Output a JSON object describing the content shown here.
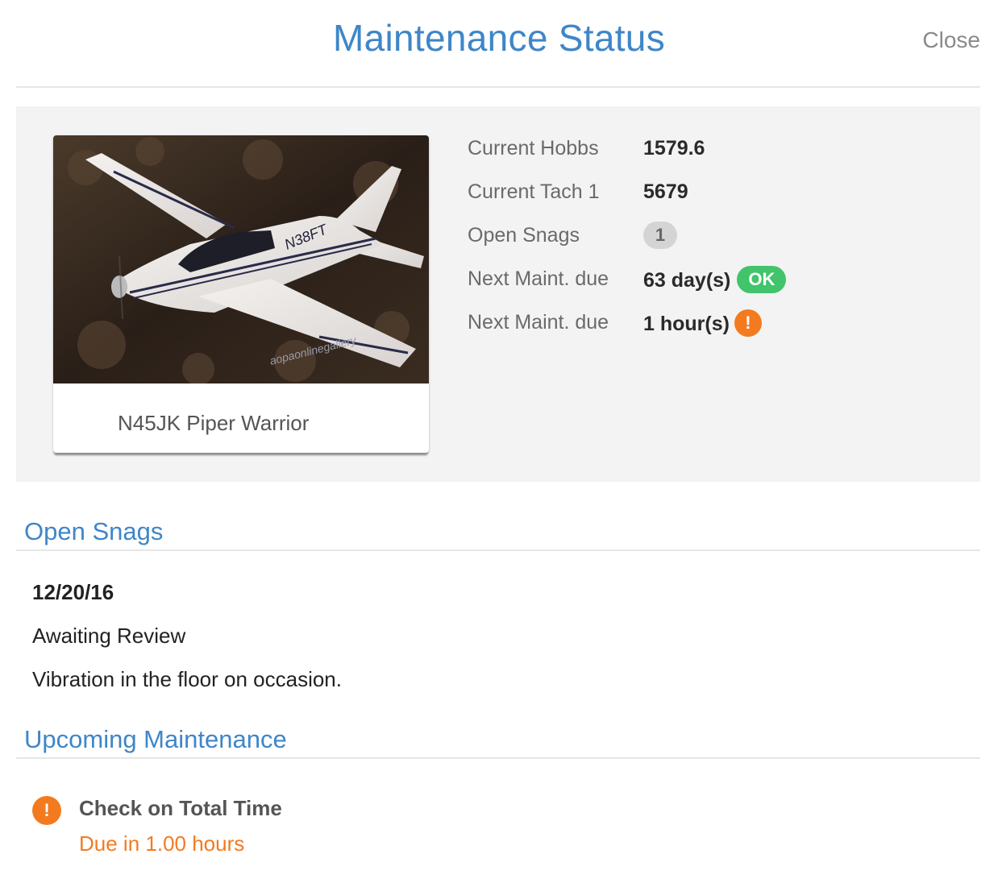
{
  "header": {
    "title": "Maintenance Status",
    "close_label": "Close"
  },
  "aircraft": {
    "caption": "N45JK Piper Warrior",
    "photo_tail_marking": "N38FT",
    "photo_credit_text": "aopaonlinegallery"
  },
  "stats": {
    "hobbs": {
      "label": "Current Hobbs",
      "value": "1579.6"
    },
    "tach": {
      "label": "Current Tach 1",
      "value": "5679"
    },
    "snags": {
      "label": "Open Snags",
      "value": "1"
    },
    "maint_days": {
      "label": "Next Maint. due",
      "value": "63 day(s)",
      "badge": "OK"
    },
    "maint_hours": {
      "label": "Next Maint. due",
      "value": "1 hour(s)",
      "badge": "!"
    }
  },
  "open_snags": {
    "title": "Open Snags",
    "items": [
      {
        "date": "12/20/16",
        "status": "Awaiting Review",
        "description": "Vibration in the floor on occasion."
      }
    ]
  },
  "upcoming": {
    "title": "Upcoming Maintenance",
    "items": [
      {
        "icon": "!",
        "title": "Check on Total Time",
        "due": "Due in 1.00 hours"
      }
    ]
  },
  "colors": {
    "accent": "#3f86c8",
    "ok": "#41c46b",
    "warning": "#f47a20",
    "panel": "#f3f3f3"
  }
}
